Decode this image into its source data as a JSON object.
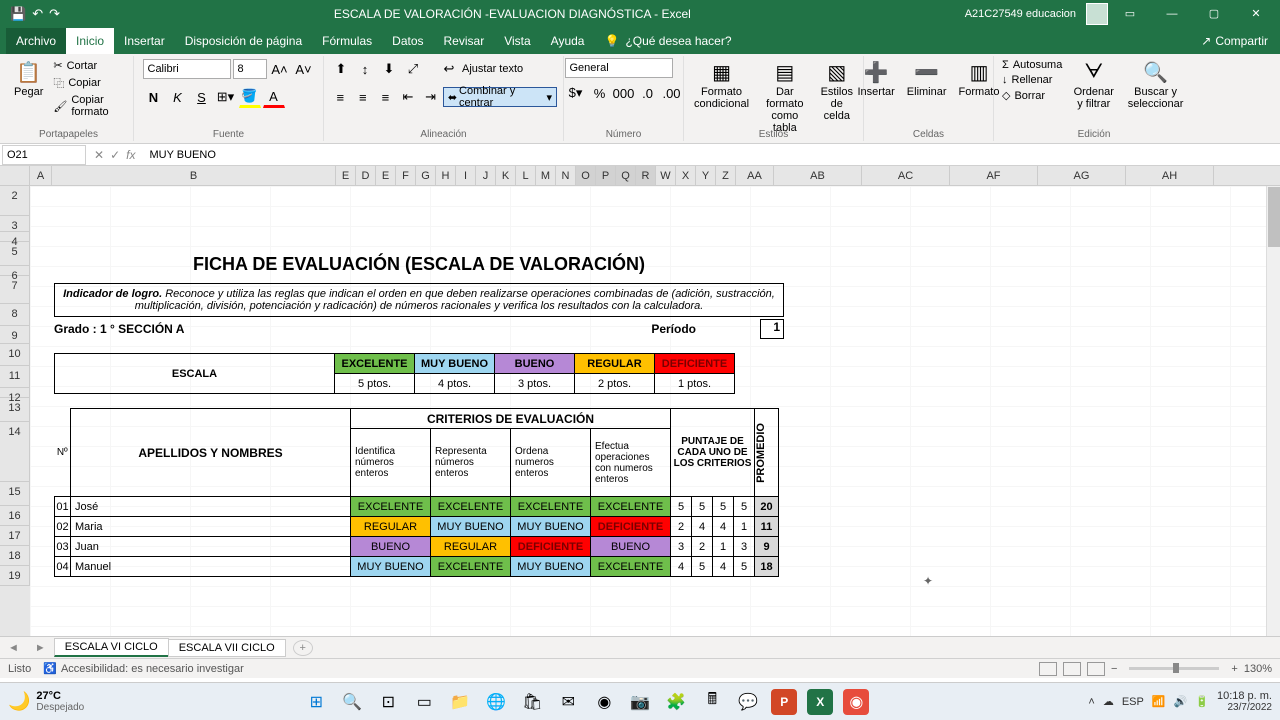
{
  "titlebar": {
    "doc_title": "ESCALA DE VALORACIÓN -EVALUACION DIAGNÓSTICA  -  Excel",
    "account": "A21C27549 educacion"
  },
  "ribbon": {
    "tabs": [
      "Archivo",
      "Inicio",
      "Insertar",
      "Disposición de página",
      "Fórmulas",
      "Datos",
      "Revisar",
      "Vista",
      "Ayuda"
    ],
    "tellme": "¿Qué desea hacer?",
    "share": "Compartir",
    "clipboard": {
      "paste": "Pegar",
      "cut": "Cortar",
      "copy": "Copiar",
      "format": "Copiar formato",
      "label": "Portapapeles"
    },
    "font": {
      "name": "Calibri",
      "size": "8",
      "label": "Fuente"
    },
    "align": {
      "wrap": "Ajustar texto",
      "merge": "Combinar y centrar",
      "label": "Alineación"
    },
    "number": {
      "format": "General",
      "label": "Número"
    },
    "styles": {
      "cond": "Formato condicional",
      "table": "Dar formato como tabla",
      "cell": "Estilos de celda",
      "label": "Estilos"
    },
    "cells": {
      "insert": "Insertar",
      "delete": "Eliminar",
      "format": "Formato",
      "label": "Celdas"
    },
    "editing": {
      "autosum": "Autosuma",
      "fill": "Rellenar",
      "clear": "Borrar",
      "sort": "Ordenar y filtrar",
      "find": "Buscar y seleccionar",
      "label": "Edición"
    }
  },
  "namebox": "O21",
  "formula": "MUY BUENO",
  "columns": [
    "A",
    "B",
    "E",
    "D",
    "E",
    "F",
    "G",
    "H",
    "I",
    "J",
    "K",
    "L",
    "M",
    "N",
    "O",
    "P",
    "Q",
    "R",
    "W",
    "X",
    "Y",
    "Z",
    "AA",
    "AB",
    "AC",
    "AF",
    "AG",
    "AH"
  ],
  "rows": [
    "2",
    "3",
    "4",
    "5",
    "6",
    "7",
    "8",
    "9",
    "10",
    "11",
    "12",
    "13",
    "14",
    "15",
    "16",
    "17",
    "18",
    "19"
  ],
  "sheet": {
    "title": "FICHA  DE  EVALUACIÓN  (ESCALA DE VALORACIÓN)",
    "indicador_label": "Indicador de logro.",
    "indicador_text": "Reconoce y utiliza las reglas que indican el orden en que deben realizarse operaciones combinadas de (adición, sustracción, multiplicación, división, potenciación y radicación) de números racionales y verifica los resultados con la calculadora.",
    "grado": "Grado :   1 °   SECCIÓN A",
    "periodo_label": "Período",
    "periodo_value": "1",
    "escala_label": "ESCALA",
    "escala_headers": [
      "EXCELENTE",
      "MUY BUENO",
      "BUENO",
      "REGULAR",
      "DEFICIENTE"
    ],
    "escala_pts": [
      "5 ptos.",
      "4 ptos.",
      "3 ptos.",
      "2 ptos.",
      "1 ptos."
    ],
    "criterios_title": "CRITERIOS DE EVALUACIÓN",
    "num_label": "Nº",
    "apellidos_label": "APELLIDOS  Y  NOMBRES",
    "criterios": [
      "Identifica números enteros",
      "Representa números enteros",
      "Ordena numeros enteros",
      "Efectua operaciones con numeros enteros"
    ],
    "puntaje_label": "PUNTAJE DE CADA UNO DE LOS CRITERIOS",
    "promedio_label": "PROMEDIO",
    "students": [
      {
        "n": "01",
        "name": "José",
        "grades": [
          "EXCELENTE",
          "EXCELENTE",
          "EXCELENTE",
          "EXCELENTE"
        ],
        "scores": [
          "5",
          "5",
          "5",
          "5"
        ],
        "prom": "20"
      },
      {
        "n": "02",
        "name": "Maria",
        "grades": [
          "REGULAR",
          "MUY BUENO",
          "MUY BUENO",
          "DEFICIENTE"
        ],
        "scores": [
          "2",
          "4",
          "4",
          "1"
        ],
        "prom": "11"
      },
      {
        "n": "03",
        "name": "Juan",
        "grades": [
          "BUENO",
          "REGULAR",
          "DEFICIENTE",
          "BUENO"
        ],
        "scores": [
          "3",
          "2",
          "1",
          "3"
        ],
        "prom": "9"
      },
      {
        "n": "04",
        "name": "Manuel",
        "grades": [
          "MUY BUENO",
          "EXCELENTE",
          "MUY BUENO",
          "EXCELENTE"
        ],
        "scores": [
          "4",
          "5",
          "4",
          "5"
        ],
        "prom": "18"
      }
    ]
  },
  "tabs": {
    "active": "ESCALA VI CICLO",
    "other": "ESCALA VII CICLO"
  },
  "status": {
    "ready": "Listo",
    "access": "Accesibilidad: es necesario investigar",
    "zoom": "130%"
  },
  "taskbar": {
    "temp": "27°C",
    "weather": "Despejado",
    "time": "10:18 p. m.",
    "date": "23/7/2022",
    "lang": "ESP"
  }
}
